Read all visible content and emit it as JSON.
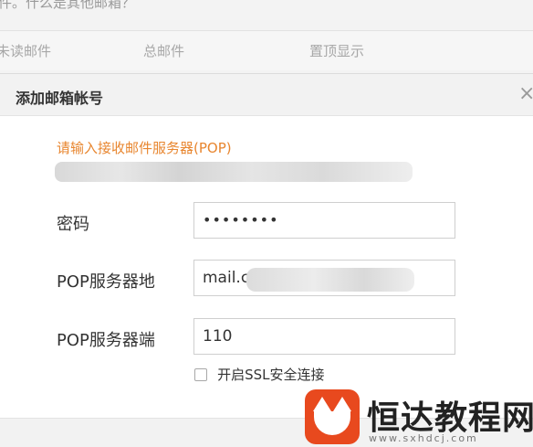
{
  "background": {
    "hint": "件。什么是其他邮箱？",
    "columns": [
      "未读邮件",
      "总邮件",
      "置顶显示"
    ]
  },
  "dialog": {
    "title": "添加邮箱帐号",
    "close_label": "×",
    "prompt": "请输入接收邮件服务器(POP)",
    "fields": {
      "password": {
        "label": "密码",
        "value": "••••••••"
      },
      "pop_host": {
        "label": "POP服务器地",
        "value": "mail.c"
      },
      "pop_port": {
        "label": "POP服务器端",
        "value": "110"
      }
    },
    "ssl_checkbox": {
      "label": "开启SSL安全连接",
      "checked": false
    }
  },
  "watermark": {
    "text": "恒达教程网",
    "subtext": "www.sxhdcj.com"
  },
  "colors": {
    "prompt": "#e8862f",
    "header_bg": "#f2f2f2",
    "brand": "#e8491e"
  }
}
